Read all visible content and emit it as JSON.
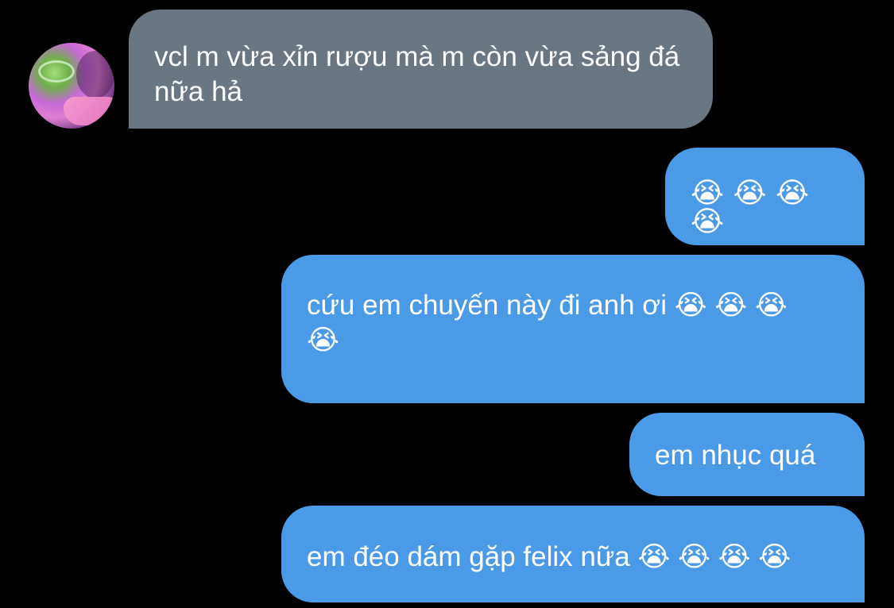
{
  "conversation": {
    "contact": {
      "avatar_icon": "profile-photo"
    },
    "messages": [
      {
        "direction": "incoming",
        "text": "vcl m vừa xỉn rượu mà m còn vừa sảng đá nữa hả"
      },
      {
        "direction": "outgoing",
        "text": "😭 😭 😭 😭"
      },
      {
        "direction": "outgoing",
        "text": "cứu em chuyến này đi anh ơi 😭 😭 😭 😭"
      },
      {
        "direction": "outgoing",
        "text": "em nhục quá"
      },
      {
        "direction": "outgoing",
        "text": "em đéo dám gặp felix nữa 😭 😭 😭 😭"
      }
    ]
  },
  "colors": {
    "background": "#000000",
    "incoming_bubble": "#6a7682",
    "outgoing_bubble": "#4b9ae8",
    "text": "#ffffff"
  }
}
